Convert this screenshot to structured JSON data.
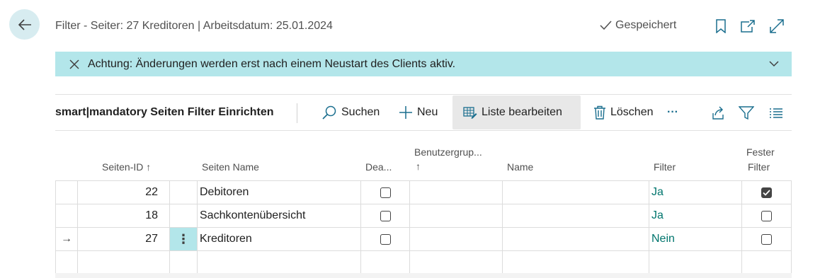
{
  "header": {
    "title": "Filter - Seiter: 27 Kreditoren | Arbeitsdatum: 25.01.2024",
    "saved_label": "Gespeichert"
  },
  "banner": {
    "message": "Achtung: Änderungen werden erst nach einem Neustart des Clients aktiv."
  },
  "actionbar": {
    "title": "smart|mandatory Seiten Filter Einrichten",
    "search_label": "Suchen",
    "new_label": "Neu",
    "edit_list_label": "Liste bearbeiten",
    "delete_label": "Löschen",
    "more_label": "···"
  },
  "table": {
    "headers": {
      "seiten_id": "Seiten-ID",
      "seiten_name": "Seiten Name",
      "deaktiviert": "Dea...",
      "benutzergruppe": "Benutzergrup...",
      "name": "Name",
      "filter": "Filter",
      "fester_filter_line1": "Fester",
      "fester_filter_line2": "Filter"
    },
    "sort_arrow": "↑",
    "rows": [
      {
        "id": "22",
        "name": "Debitoren",
        "deaktiviert": false,
        "benutzergruppe": "",
        "bname": "",
        "filter": "Ja",
        "fester": true,
        "selected": false
      },
      {
        "id": "18",
        "name": "Sachkontenübersicht",
        "deaktiviert": false,
        "benutzergruppe": "",
        "bname": "",
        "filter": "Ja",
        "fester": false,
        "selected": false
      },
      {
        "id": "27",
        "name": "Kreditoren",
        "deaktiviert": false,
        "benutzergruppe": "",
        "bname": "",
        "filter": "Nein",
        "fester": false,
        "selected": true
      }
    ],
    "row_menu_glyph": "⋮",
    "selected_marker": "→"
  },
  "colors": {
    "accent": "#b3e6ea",
    "link": "#00756d"
  }
}
